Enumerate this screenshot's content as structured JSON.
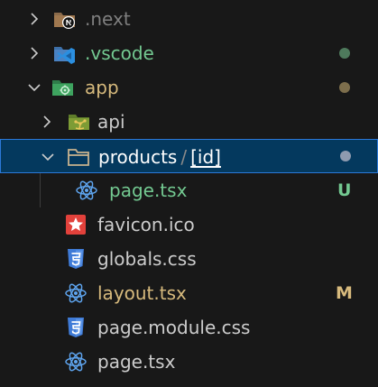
{
  "tree": {
    "items": [
      {
        "label": "next",
        "prefix": ".",
        "icon": "nextjs-folder-icon",
        "color": "#7f7f7f",
        "expanded": false
      },
      {
        "label": "vscode",
        "prefix": ".",
        "icon": "vscode-folder-icon",
        "color": "#73c991",
        "status": "dot",
        "status_color": "#4e7a5c",
        "expanded": false
      },
      {
        "label": "app",
        "icon": "app-folder-icon",
        "color": "#d7ba7d",
        "status": "dot",
        "status_color": "#7d6e4c",
        "expanded": true
      },
      {
        "label": "api",
        "icon": "api-folder-icon",
        "color": "#cccccc",
        "expanded": false
      },
      {
        "label": "products",
        "sep": "/",
        "id": "[id]",
        "icon": "folder-open-icon",
        "color": "#ffffff",
        "status": "dot",
        "status_color": "#8f9bb0",
        "expanded": true
      },
      {
        "label": "page.tsx",
        "icon": "react-icon",
        "color": "#73c991",
        "status": "U",
        "status_color": "#73c991"
      },
      {
        "label": "favicon.ico",
        "icon": "favicon-icon",
        "color": "#cccccc"
      },
      {
        "label": "globals.css",
        "icon": "css-icon",
        "color": "#cccccc"
      },
      {
        "label": "layout.tsx",
        "icon": "react-icon",
        "color": "#d7ba7d",
        "status": "M",
        "status_color": "#d7ba7d"
      },
      {
        "label": "page.module.css",
        "icon": "css-icon",
        "color": "#cccccc"
      },
      {
        "label": "page.tsx",
        "icon": "react-icon",
        "color": "#cccccc"
      }
    ]
  },
  "colors": {
    "background": "#181818",
    "selection": "#04395e",
    "selection_border": "#2b79d8",
    "react": "#5ea4ee",
    "css": "#3f7bd7",
    "favicon": "#e2413b"
  }
}
